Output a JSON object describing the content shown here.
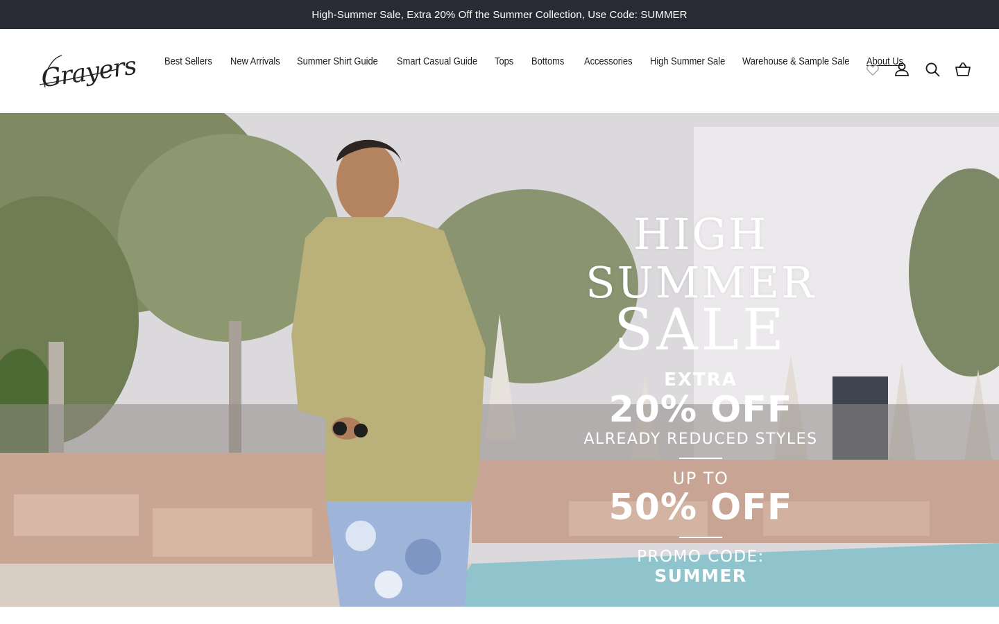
{
  "announcement": {
    "text": "High-Summer Sale, Extra 20% Off the Summer Collection, Use Code: SUMMER"
  },
  "header": {
    "logo_text": "Grayers",
    "nav": [
      {
        "label": "Best Sellers"
      },
      {
        "label": "New Arrivals"
      },
      {
        "label": "Summer Shirt Guide"
      },
      {
        "label": "Smart Casual Guide"
      },
      {
        "label": "Tops"
      },
      {
        "label": "Bottoms"
      },
      {
        "label": "Accessories"
      },
      {
        "label": "High Summer Sale"
      },
      {
        "label": "Warehouse & Sample Sale"
      },
      {
        "label": "About Us"
      }
    ],
    "icons": [
      "heart-icon",
      "account-icon",
      "search-icon",
      "cart-icon"
    ]
  },
  "hero": {
    "title": "HIGH SUMMER",
    "subtitle": "SALE",
    "extra": "EXTRA",
    "discount1": "20% OFF",
    "discount1_note": "ALREADY REDUCED STYLES",
    "upto": "UP TO",
    "discount2": "50% OFF",
    "promo_label": "PROMO CODE:",
    "promo_code": "SUMMER"
  },
  "colors": {
    "announcement_bg": "#282b33",
    "text": "#1a1a1a",
    "hero_text": "#ffffff"
  }
}
